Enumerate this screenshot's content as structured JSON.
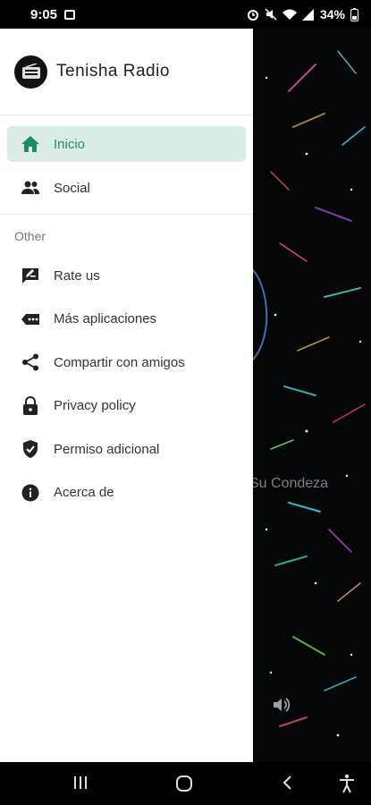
{
  "status": {
    "time": "9:05",
    "battery": "34%",
    "icons": [
      "gallery-icon",
      "alarm-icon",
      "mute-icon",
      "wifi-icon",
      "signal-icon",
      "battery-icon"
    ]
  },
  "drawer": {
    "app_title": "Tenisha Radio",
    "items": [
      {
        "label": "Inicio",
        "icon": "home-icon",
        "active": true
      },
      {
        "label": "Social",
        "icon": "people-icon",
        "active": false
      }
    ],
    "section_label": "Other",
    "other_items": [
      {
        "label": "Rate us",
        "icon": "rate-icon"
      },
      {
        "label": "Más aplicaciones",
        "icon": "more-apps-icon"
      },
      {
        "label": "Compartir con amigos",
        "icon": "share-icon"
      },
      {
        "label": "Privacy policy",
        "icon": "lock-icon"
      },
      {
        "label": "Permiso adicional",
        "icon": "shield-icon"
      },
      {
        "label": "Acerca de",
        "icon": "info-icon"
      }
    ]
  },
  "background": {
    "visible_text": "Su Condeza"
  },
  "colors": {
    "accent": "#1f8a6c",
    "active_bg": "#dbece6"
  }
}
